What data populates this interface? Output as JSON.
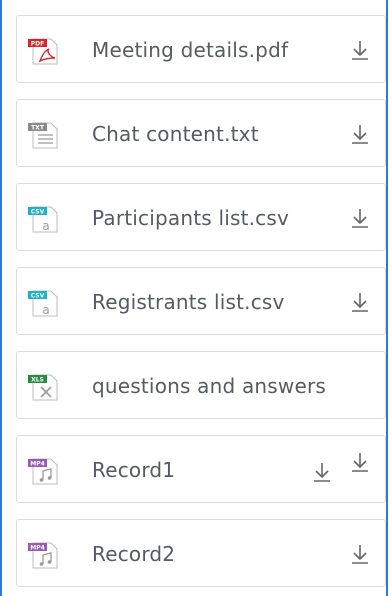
{
  "files": [
    {
      "name": "Meeting details.pdf",
      "icon": "pdf-file-icon",
      "badge": "PDF",
      "badge_color": "#d9262c"
    },
    {
      "name": "Chat content.txt",
      "icon": "txt-file-icon",
      "badge": "TXT",
      "badge_color": "#8a8a8a"
    },
    {
      "name": "Participants list.csv",
      "icon": "csv-file-icon",
      "badge": "CSV",
      "badge_color": "#1fb1c7"
    },
    {
      "name": "Registrants list.csv",
      "icon": "csv-file-icon",
      "badge": "CSV",
      "badge_color": "#1fb1c7"
    },
    {
      "name": "questions and answers",
      "icon": "xls-file-icon",
      "badge": "XLS",
      "badge_color": "#2a8a44"
    },
    {
      "name": "Record1",
      "icon": "mp4-file-icon",
      "badge": "MP4",
      "badge_color": "#9b59b6"
    },
    {
      "name": "Record2",
      "icon": "mp4-file-icon",
      "badge": "MP4",
      "badge_color": "#9b59b6"
    }
  ],
  "colors": {
    "border_accent": "#2b7bd6",
    "text": "#555b62",
    "icon_gray": "#666666"
  }
}
